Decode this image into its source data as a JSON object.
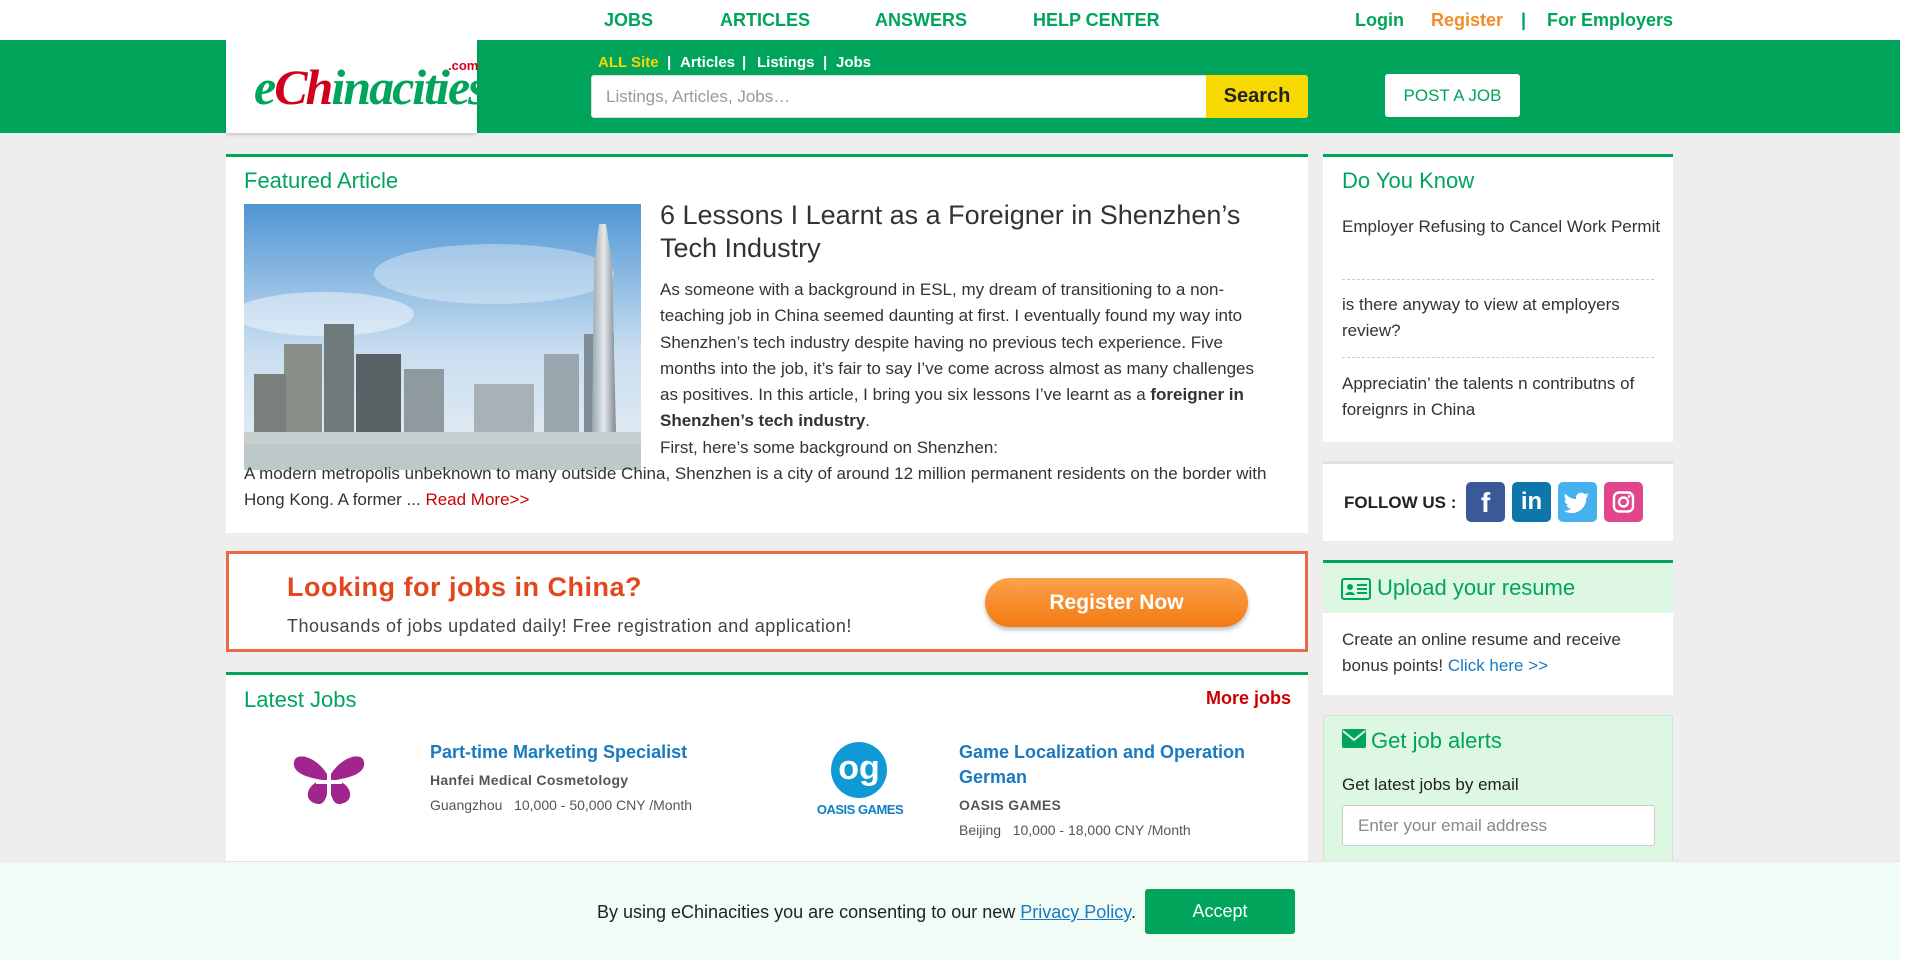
{
  "top_nav": [
    "JOBS",
    "ARTICLES",
    "ANSWERS",
    "HELP CENTER"
  ],
  "auth": {
    "login": "Login",
    "register": "Register",
    "divider": "|",
    "employers": "For Employers"
  },
  "logo": {
    "e": "e",
    "ch": "Ch",
    "rest": "inacities",
    "com": ".com"
  },
  "search": {
    "scopes": [
      "ALL Site",
      "Articles",
      "Listings",
      "Jobs"
    ],
    "separator": "|",
    "placeholder": "Listings, Articles, Jobs…",
    "button": "Search"
  },
  "post_job": "POST A JOB",
  "featured": {
    "heading": "Featured Article",
    "title": "6 Lessons I Learnt as a Foreigner in Shenzhen’s Tech Industry",
    "body_1": "As someone with a background in ESL, my dream of transitioning to a non-teaching job in China seemed daunting at first. I eventually found my way into Shenzhen’s tech industry despite having no previous tech experience. Five months into the job, it’s fair to say I’ve come across almost as many challenges as positives. In this article, I bring you six lessons I’ve learnt as a ",
    "body_bold": "foreigner in Shenzhen’s tech industry",
    "body_2": ".",
    "body_3": "First, here’s some background on Shenzhen:",
    "body_4": "A modern metropolis unbeknown to many outside China, Shenzhen is a city of around 12 million permanent residents on the border with Hong Kong. A former ... ",
    "read_more": "Read More>>"
  },
  "banner": {
    "headline": "Looking for jobs in China?",
    "subline": "Thousands of jobs updated daily!  Free registration and application!",
    "button": "Register Now"
  },
  "latest_jobs": {
    "heading": "Latest Jobs",
    "more": "More jobs",
    "items": [
      {
        "title": "Part-time Marketing Specialist",
        "company": "Hanfei Medical Cosmetology",
        "city": "Guangzhou",
        "salary": "10,000 - 50,000 CNY /Month",
        "logo": "butterfly-logo"
      },
      {
        "title": "Game Localization and Operation German",
        "company": "OASIS GAMES",
        "city": "Beijing",
        "salary": "10,000 - 18,000 CNY /Month",
        "logo_text": "og",
        "logo_caption": "OASIS GAMES"
      }
    ]
  },
  "do_you_know": {
    "heading": "Do You Know",
    "items": [
      "Employer Refusing to Cancel Work Permit",
      "is there anyway to view at employers review?",
      "Appreciatin’ the talents n contributns of foreignrs in China"
    ]
  },
  "follow": {
    "label": "FOLLOW US :",
    "networks": [
      {
        "icon": "facebook-icon",
        "glyph": "f",
        "color": "#3b5998"
      },
      {
        "icon": "linkedin-icon",
        "glyph": "in",
        "color": "#0e76a8"
      },
      {
        "icon": "twitter-icon",
        "color": "#45b1ef"
      },
      {
        "icon": "instagram-icon",
        "color": "#e1468d"
      }
    ]
  },
  "upload": {
    "heading": "Upload your resume",
    "text": "Create an online resume and receive bonus points! ",
    "link": "Click here >>"
  },
  "alerts": {
    "heading": "Get job alerts",
    "text": "Get latest jobs by email",
    "placeholder": "Enter your email address"
  },
  "cookie": {
    "text": "By using eChinacities you are consenting to our new ",
    "link": "Privacy Policy",
    "end": ".",
    "accept": "Accept"
  },
  "colors": {
    "brand_green": "#00a45a",
    "accent_yellow": "#f7d800",
    "link_blue": "#1a7abf",
    "alert_red": "#cc0000",
    "orange": "#f28c28"
  }
}
